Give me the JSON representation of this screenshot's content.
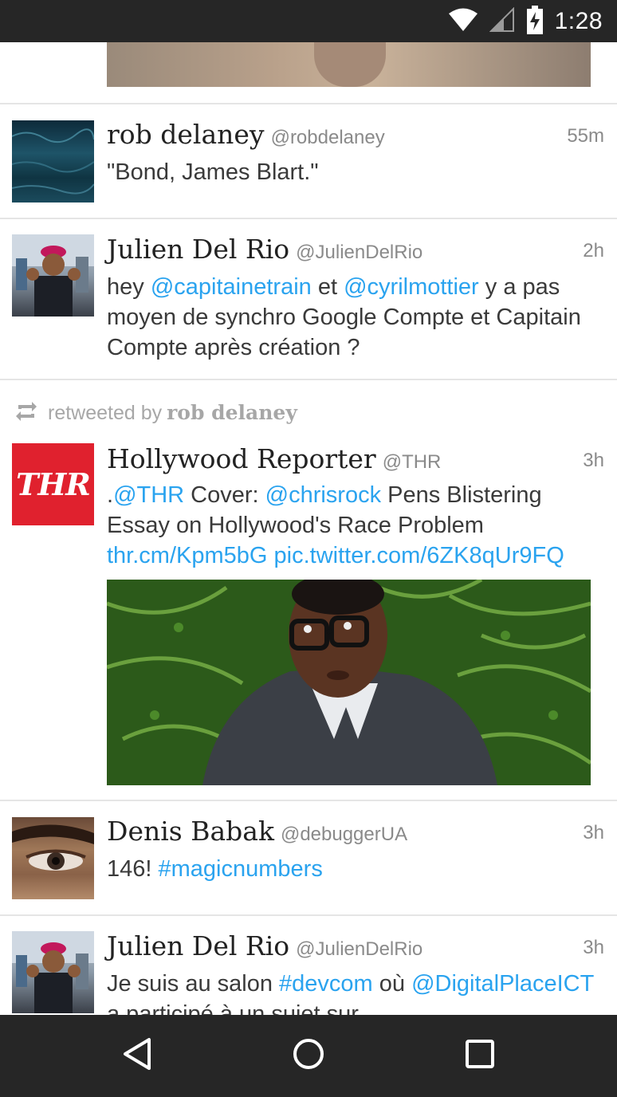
{
  "status_bar": {
    "time": "1:28",
    "icons": [
      "wifi-icon",
      "cell-signal-icon",
      "battery-charging-icon"
    ]
  },
  "retweet_banner": {
    "prefix": "retweeted by",
    "name": "rob delaney"
  },
  "tweets": [
    {
      "name": "rob delaney",
      "handle": "@robdelaney",
      "time": "55m",
      "text": "\"Bond, James Blart.\""
    },
    {
      "name": "Julien Del Rio",
      "handle": "@JulienDelRio",
      "time": "2h",
      "text_parts": [
        "hey ",
        "@capitainetrain",
        " et ",
        "@cyrilmottier",
        " y a pas moyen de synchro Google Compte et Capitain Compte après création ?"
      ]
    },
    {
      "name": "Hollywood Reporter",
      "handle": "@THR",
      "time": "3h",
      "avatar_text": "THR",
      "text_parts": [
        ".",
        "@THR",
        " Cover: ",
        "@chrisrock",
        " Pens Blistering Essay on Hollywood's Race Problem ",
        "thr.cm/Kpm5bG",
        " ",
        "pic.twitter.com/6ZK8qUr9FQ"
      ]
    },
    {
      "name": "Denis Babak",
      "handle": "@debuggerUA",
      "time": "3h",
      "text_parts": [
        "146! ",
        "#magicnumbers"
      ]
    },
    {
      "name": "Julien Del Rio",
      "handle": "@JulienDelRio",
      "time": "3h",
      "text_parts": [
        "Je suis au salon ",
        "#devcom",
        " où ",
        "@DigitalPlaceICT",
        " a participé à un sujet sur"
      ]
    }
  ],
  "colors": {
    "link": "#2aa3ef",
    "bars": "#262626",
    "thr_red": "#e0212e"
  },
  "nav": {
    "icons": [
      "back-icon",
      "home-icon",
      "recents-icon"
    ]
  }
}
